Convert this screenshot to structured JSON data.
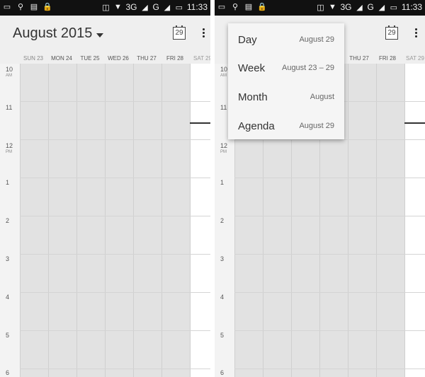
{
  "status_bar": {
    "time": "11:33",
    "network": "3G",
    "network_secondary": "G",
    "icons": [
      "screenshot-icon",
      "usb-icon",
      "message-icon",
      "lock-icon",
      "vibrate-icon",
      "wifi-icon",
      "signal-icon",
      "battery-icon"
    ]
  },
  "toolbar": {
    "title": "August 2015",
    "today_date": "29"
  },
  "week": {
    "days": [
      "SUN 23",
      "MON 24",
      "TUE 25",
      "WED 26",
      "THU 27",
      "FRI 28",
      "SAT 29"
    ]
  },
  "time_labels": [
    {
      "hour": "10",
      "period": "AM"
    },
    {
      "hour": "11",
      "period": ""
    },
    {
      "hour": "12",
      "period": "PM"
    },
    {
      "hour": "1",
      "period": ""
    },
    {
      "hour": "2",
      "period": ""
    },
    {
      "hour": "3",
      "period": ""
    },
    {
      "hour": "4",
      "period": ""
    },
    {
      "hour": "5",
      "period": ""
    },
    {
      "hour": "6",
      "period": ""
    }
  ],
  "view_menu": {
    "items": [
      {
        "label": "Day",
        "range": "August 29"
      },
      {
        "label": "Week",
        "range": "August 23 – 29"
      },
      {
        "label": "Month",
        "range": "August"
      },
      {
        "label": "Agenda",
        "range": "August 29"
      }
    ]
  },
  "colors": {
    "status_bar": "#111111",
    "toolbar": "#efefef",
    "past_day_fill": "#e2e2e2",
    "today_fill": "#ffffff",
    "now_line": "#333333"
  }
}
